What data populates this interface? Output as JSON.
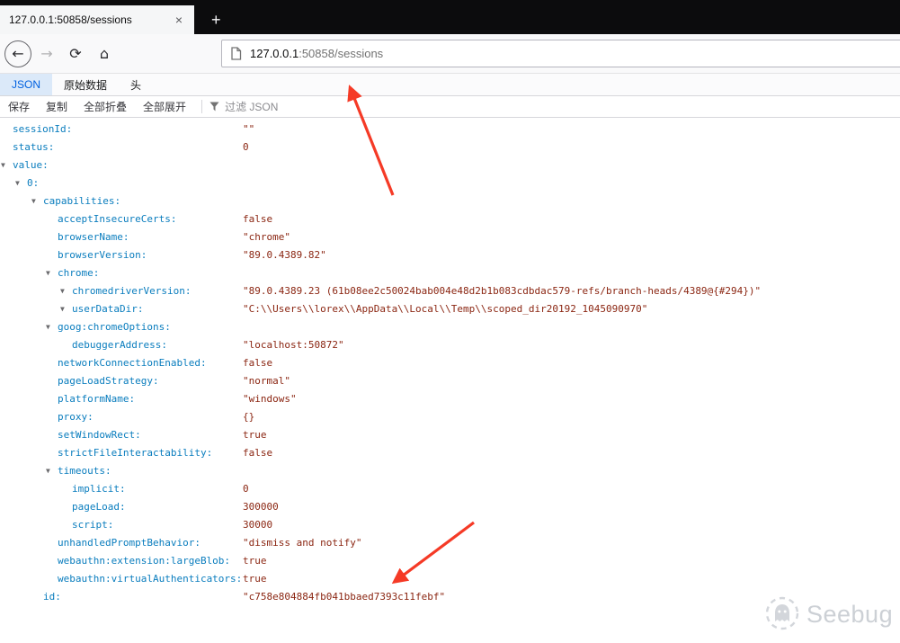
{
  "colors": {
    "json_key": "#0a7dbe",
    "json_value": "#8b2612",
    "twisty": "#6a6a6d",
    "annotation_arrow": "#f53a26",
    "active_tab_text": "#0061e0",
    "tabbar_bg": "#0c0c0d"
  },
  "browser": {
    "tab_title": "127.0.0.1:50858/sessions",
    "close_tab_glyph": "×",
    "new_tab_glyph": "+",
    "back_glyph": "←",
    "forward_glyph": "→",
    "reload_glyph": "⟳",
    "home_glyph": "⌂",
    "url_host": "127.0.0.1",
    "url_rest": ":50858/sessions"
  },
  "viewer": {
    "tabs": [
      {
        "label": "JSON"
      },
      {
        "label": "原始数据"
      },
      {
        "label": "头"
      }
    ],
    "toolbar": {
      "save": "保存",
      "copy": "复制",
      "collapse_all": "全部折叠",
      "expand_all": "全部展开",
      "filter_placeholder": "过滤 JSON"
    }
  },
  "json_tree": {
    "indents": [
      14,
      30,
      48,
      64,
      80
    ],
    "value_column": 270,
    "rows": [
      {
        "level": 0,
        "expandable": false,
        "key": "sessionId:",
        "value": "\"\""
      },
      {
        "level": 0,
        "expandable": false,
        "key": "status:",
        "value": "0"
      },
      {
        "level": 0,
        "expandable": true,
        "key": "value:",
        "value": ""
      },
      {
        "level": 1,
        "expandable": true,
        "key": "0:",
        "value": ""
      },
      {
        "level": 2,
        "expandable": true,
        "key": "capabilities:",
        "value": ""
      },
      {
        "level": 3,
        "expandable": false,
        "key": "acceptInsecureCerts:",
        "value": "false"
      },
      {
        "level": 3,
        "expandable": false,
        "key": "browserName:",
        "value": "\"chrome\""
      },
      {
        "level": 3,
        "expandable": false,
        "key": "browserVersion:",
        "value": "\"89.0.4389.82\""
      },
      {
        "level": 3,
        "expandable": true,
        "key": "chrome:",
        "value": ""
      },
      {
        "level": 4,
        "expandable": true,
        "key": "chromedriverVersion:",
        "value": "\"89.0.4389.23 (61b08ee2c50024bab004e48d2b1b083cdbdac579-refs/branch-heads/4389@{#294})\""
      },
      {
        "level": 4,
        "expandable": true,
        "key": "userDataDir:",
        "value": "\"C:\\\\Users\\\\lorex\\\\AppData\\\\Local\\\\Temp\\\\scoped_dir20192_1045090970\""
      },
      {
        "level": 3,
        "expandable": true,
        "key": "goog:chromeOptions:",
        "value": ""
      },
      {
        "level": 4,
        "expandable": false,
        "key": "debuggerAddress:",
        "value": "\"localhost:50872\""
      },
      {
        "level": 3,
        "expandable": false,
        "key": "networkConnectionEnabled:",
        "value": "false"
      },
      {
        "level": 3,
        "expandable": false,
        "key": "pageLoadStrategy:",
        "value": "\"normal\""
      },
      {
        "level": 3,
        "expandable": false,
        "key": "platformName:",
        "value": "\"windows\""
      },
      {
        "level": 3,
        "expandable": false,
        "key": "proxy:",
        "value": "{}"
      },
      {
        "level": 3,
        "expandable": false,
        "key": "setWindowRect:",
        "value": "true"
      },
      {
        "level": 3,
        "expandable": false,
        "key": "strictFileInteractability:",
        "value": "false"
      },
      {
        "level": 3,
        "expandable": true,
        "key": "timeouts:",
        "value": ""
      },
      {
        "level": 4,
        "expandable": false,
        "key": "implicit:",
        "value": "0"
      },
      {
        "level": 4,
        "expandable": false,
        "key": "pageLoad:",
        "value": "300000"
      },
      {
        "level": 4,
        "expandable": false,
        "key": "script:",
        "value": "30000"
      },
      {
        "level": 3,
        "expandable": false,
        "key": "unhandledPromptBehavior:",
        "value": "\"dismiss and notify\""
      },
      {
        "level": 3,
        "expandable": false,
        "key": "webauthn:extension:largeBlob:",
        "value": "true"
      },
      {
        "level": 3,
        "expandable": false,
        "key": "webauthn:virtualAuthenticators:",
        "value": "true"
      },
      {
        "level": 2,
        "expandable": false,
        "key": "id:",
        "value": "\"c758e804884fb041bbaed7393c11febf\""
      }
    ]
  },
  "watermark": {
    "text": "Seebug"
  }
}
